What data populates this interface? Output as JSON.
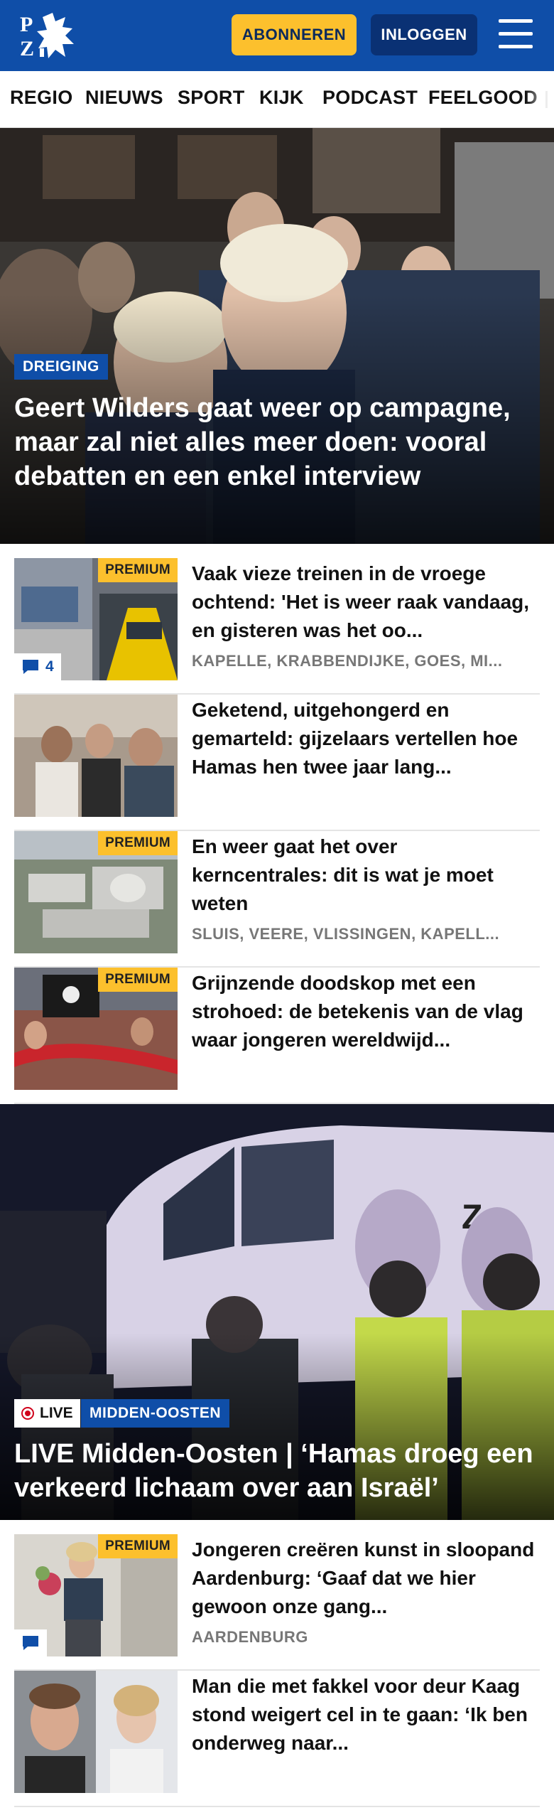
{
  "header": {
    "logo_text": "PZC",
    "subscribe_label": "ABONNEREN",
    "login_label": "INLOGGEN"
  },
  "nav": {
    "items": [
      "REGIO",
      "NIEUWS",
      "SPORT",
      "KIJK",
      "PODCAST",
      "FEELGOOD"
    ]
  },
  "hero": {
    "tag": "DREIGING",
    "title": "Geert Wilders gaat weer op campagne, maar zal niet alles meer doen: vooral debatten en een enkel interview"
  },
  "articles": [
    {
      "premium": "PREMIUM",
      "comments": "4",
      "title": "Vaak vieze treinen in de vroege ochtend: 'Het is weer raak vandaag, en gisteren was het oo...",
      "location": "KAPELLE, KRABBENDIJKE, GOES, MI..."
    },
    {
      "title": "Geketend, uitgehongerd en gemarteld: gijzelaars vertellen hoe Hamas hen twee jaar lang..."
    },
    {
      "premium": "PREMIUM",
      "title": "En weer gaat het over kerncentrales: dit is wat je moet weten",
      "location": "SLUIS, VEERE, VLISSINGEN, KAPELL..."
    },
    {
      "premium": "PREMIUM",
      "title": "Grijnzende doodskop met een strohoed: de betekenis van de vlag waar jongeren wereldwijd..."
    }
  ],
  "live": {
    "live_label": "LIVE",
    "tag": "MIDDEN-OOSTEN",
    "title": "LIVE Midden-Oosten | ‘Hamas droeg een verkeerd lichaam over aan Israël’"
  },
  "articles2": [
    {
      "premium": "PREMIUM",
      "title": "Jongeren creëren kunst in sloopand Aardenburg: ‘Gaaf dat we hier gewoon onze gang...",
      "location": "AARDENBURG"
    },
    {
      "title": "Man die met fakkel voor deur Kaag stond weigert cel in te gaan: ‘Ik ben onderweg naar..."
    }
  ],
  "colors": {
    "brand_blue": "#0f4ea8",
    "accent_yellow": "#fcc02d",
    "dark_blue": "#0a3174"
  }
}
